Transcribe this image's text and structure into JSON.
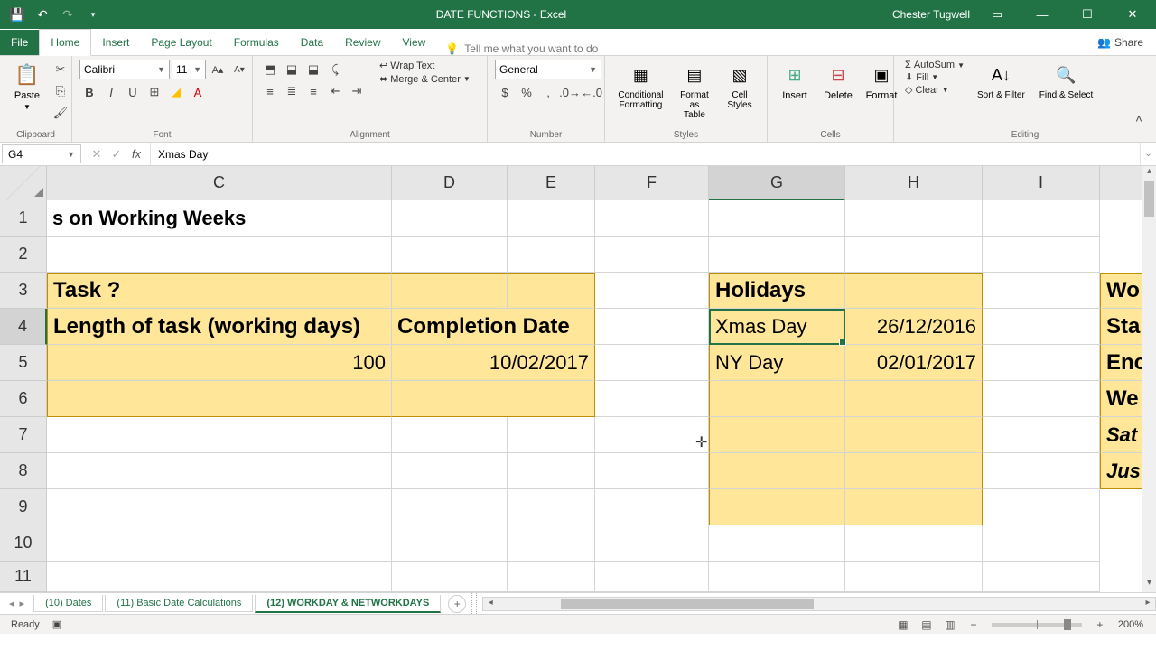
{
  "title": "DATE FUNCTIONS - Excel",
  "user": "Chester Tugwell",
  "tabs": {
    "file": "File",
    "home": "Home",
    "insert": "Insert",
    "pagelayout": "Page Layout",
    "formulas": "Formulas",
    "data": "Data",
    "review": "Review",
    "view": "View",
    "tellme": "Tell me what you want to do",
    "share": "Share"
  },
  "ribbon": {
    "clipboard": {
      "paste": "Paste",
      "label": "Clipboard"
    },
    "font": {
      "name": "Calibri",
      "size": "11",
      "label": "Font"
    },
    "alignment": {
      "wrap": "Wrap Text",
      "merge": "Merge & Center",
      "label": "Alignment"
    },
    "number": {
      "format": "General",
      "label": "Number"
    },
    "styles": {
      "cond": "Conditional Formatting",
      "table": "Format as Table",
      "cell": "Cell Styles",
      "label": "Styles"
    },
    "cells": {
      "insert": "Insert",
      "delete": "Delete",
      "format": "Format",
      "label": "Cells"
    },
    "editing": {
      "autosum": "AutoSum",
      "fill": "Fill",
      "clear": "Clear",
      "sort": "Sort & Filter",
      "find": "Find & Select",
      "label": "Editing"
    }
  },
  "namebox": "G4",
  "formula": "Xmas Day",
  "cols": {
    "C": "C",
    "D": "D",
    "E": "E",
    "F": "F",
    "G": "G",
    "H": "H",
    "I": "I"
  },
  "rows": [
    "1",
    "2",
    "3",
    "4",
    "5",
    "6",
    "7",
    "8",
    "9",
    "10",
    "11"
  ],
  "cellsdata": {
    "c1": "s on Working Weeks",
    "c3": "Task ?",
    "c4": "Length of task (working days)",
    "d4": "Completion Date",
    "c5": "100",
    "d5": "10/02/2017",
    "g3": "Holidays",
    "g4": "Xmas Day",
    "h4": "26/12/2016",
    "g5": "NY Day",
    "h5": "02/01/2017",
    "j3": "Wo",
    "j4": "Sta",
    "j5": "Enc",
    "j6": "We",
    "j7": "Sat",
    "j8": "Jus"
  },
  "sheets": {
    "s1": "(10) Dates",
    "s2": "(11) Basic Date Calculations",
    "s3": "(12) WORKDAY & NETWORKDAYS"
  },
  "status": {
    "ready": "Ready",
    "zoom": "200%"
  },
  "chart_data": null
}
